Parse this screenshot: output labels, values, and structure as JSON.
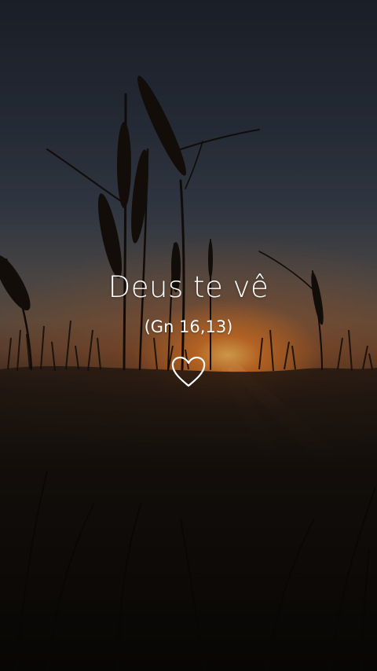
{
  "verse": {
    "text": "Deus te vê",
    "reference": "(Gn 16,13)"
  },
  "actions": {
    "favorite_icon": "heart-outline-icon"
  },
  "colors": {
    "text": "#ffffff",
    "sun": "#f5a040",
    "sky_top": "#202530"
  }
}
